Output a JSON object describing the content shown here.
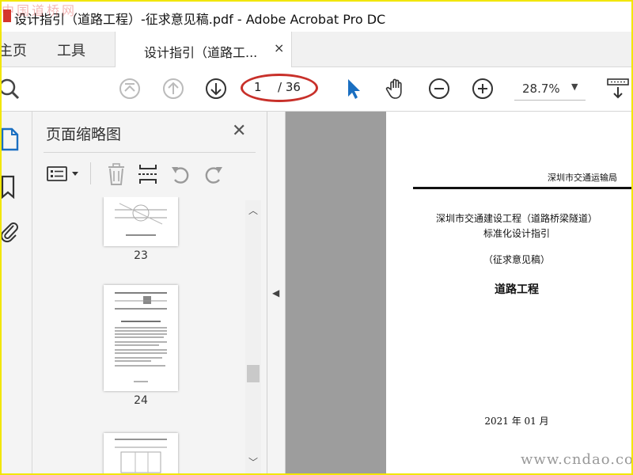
{
  "window": {
    "title": "设计指引（道路工程）-征求意见稿.pdf - Adobe Acrobat Pro DC",
    "watermark_top": "中国道桥网",
    "watermark_bottom": "www.cndao.com"
  },
  "tabs": {
    "home": "主页",
    "tools": "工具",
    "document": "设计指引（道路工...",
    "close": "×"
  },
  "toolbar": {
    "icons": [
      "search-icon",
      "first-page-icon",
      "prev-page-icon",
      "next-page-icon",
      "select-cursor-icon",
      "hand-icon",
      "zoom-out-icon",
      "zoom-in-icon",
      "scroll-mode-icon"
    ],
    "current_page": "1",
    "total_pages": "/ 36",
    "zoom": "28.7%"
  },
  "panel": {
    "title": "页面缩略图",
    "close": "✕",
    "thumbnails": [
      {
        "label": "23"
      },
      {
        "label": "24"
      },
      {
        "label": ""
      }
    ]
  },
  "document": {
    "header": "深圳市交通运输局",
    "line1": "深圳市交通建设工程（道路桥梁隧道）",
    "line2": "标准化设计指引",
    "line3": "（征求意见稿）",
    "line4": "道路工程",
    "date": "2021 年 01 月"
  },
  "colors": {
    "accent": "#1a6fc1",
    "highlight": "#c8302a",
    "doc_bg": "#9d9d9d"
  }
}
